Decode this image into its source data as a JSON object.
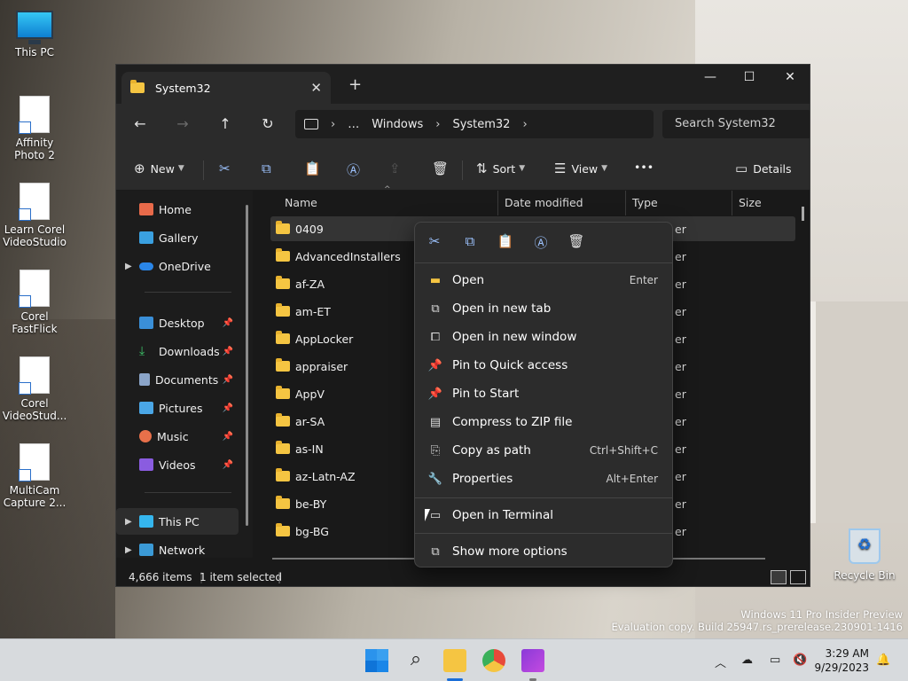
{
  "desktop": {
    "icons": [
      {
        "label": "This PC"
      },
      {
        "label": "Affinity Photo 2"
      },
      {
        "label": "Learn Corel VideoStudio"
      },
      {
        "label": "Corel FastFlick"
      },
      {
        "label": "Corel VideoStud..."
      },
      {
        "label": "MultiCam Capture 2..."
      }
    ],
    "recycle_bin": "Recycle Bin",
    "watermark_line1": "Windows 11 Pro Insider Preview",
    "watermark_line2": "Evaluation copy. Build 25947.rs_prerelease.230901-1416"
  },
  "window": {
    "tab_title": "System32",
    "tab_close": "✕",
    "new_tab": "+",
    "minimize": "—",
    "maximize": "☐",
    "close": "✕",
    "nav": {
      "back": "←",
      "forward": "→",
      "up": "↑",
      "refresh": "↻"
    },
    "breadcrumb": [
      "…",
      "Windows",
      "System32"
    ],
    "search_placeholder": "Search System32",
    "commands": {
      "new_label": "New",
      "sort_label": "Sort",
      "view_label": "View",
      "more": "•••",
      "details_label": "Details"
    },
    "sidebar": [
      {
        "label": "Home"
      },
      {
        "label": "Gallery"
      },
      {
        "label": "OneDrive"
      },
      {
        "label": "Desktop"
      },
      {
        "label": "Downloads"
      },
      {
        "label": "Documents"
      },
      {
        "label": "Pictures"
      },
      {
        "label": "Music"
      },
      {
        "label": "Videos"
      },
      {
        "label": "This PC"
      },
      {
        "label": "Network"
      }
    ],
    "columns": {
      "name": "Name",
      "date": "Date modified",
      "type": "Type",
      "size": "Size"
    },
    "files": [
      {
        "name": "0409",
        "type": "er"
      },
      {
        "name": "AdvancedInstallers",
        "type": "er"
      },
      {
        "name": "af-ZA",
        "type": "er"
      },
      {
        "name": "am-ET",
        "type": "er"
      },
      {
        "name": "AppLocker",
        "type": "er"
      },
      {
        "name": "appraiser",
        "type": "er"
      },
      {
        "name": "AppV",
        "type": "er"
      },
      {
        "name": "ar-SA",
        "type": "er"
      },
      {
        "name": "as-IN",
        "type": "er"
      },
      {
        "name": "az-Latn-AZ",
        "type": "er"
      },
      {
        "name": "be-BY",
        "type": "er"
      },
      {
        "name": "bg-BG",
        "type": "er"
      }
    ],
    "status": {
      "items": "4,666 items",
      "selected": "1 item selected"
    }
  },
  "context_menu": {
    "items": [
      {
        "label": "Open",
        "shortcut": "Enter"
      },
      {
        "label": "Open in new tab",
        "shortcut": ""
      },
      {
        "label": "Open in new window",
        "shortcut": ""
      },
      {
        "label": "Pin to Quick access",
        "shortcut": ""
      },
      {
        "label": "Pin to Start",
        "shortcut": ""
      },
      {
        "label": "Compress to ZIP file",
        "shortcut": ""
      },
      {
        "label": "Copy as path",
        "shortcut": "Ctrl+Shift+C"
      },
      {
        "label": "Properties",
        "shortcut": "Alt+Enter"
      },
      {
        "label": "Open in Terminal",
        "shortcut": ""
      },
      {
        "label": "Show more options",
        "shortcut": ""
      }
    ]
  },
  "taskbar": {
    "time": "3:29 AM",
    "date": "9/29/2023",
    "tray_chevron": "︿"
  },
  "colors": {
    "accent": "#9dc3ff",
    "folder": "#f5c542",
    "window_bg": "#191919"
  }
}
